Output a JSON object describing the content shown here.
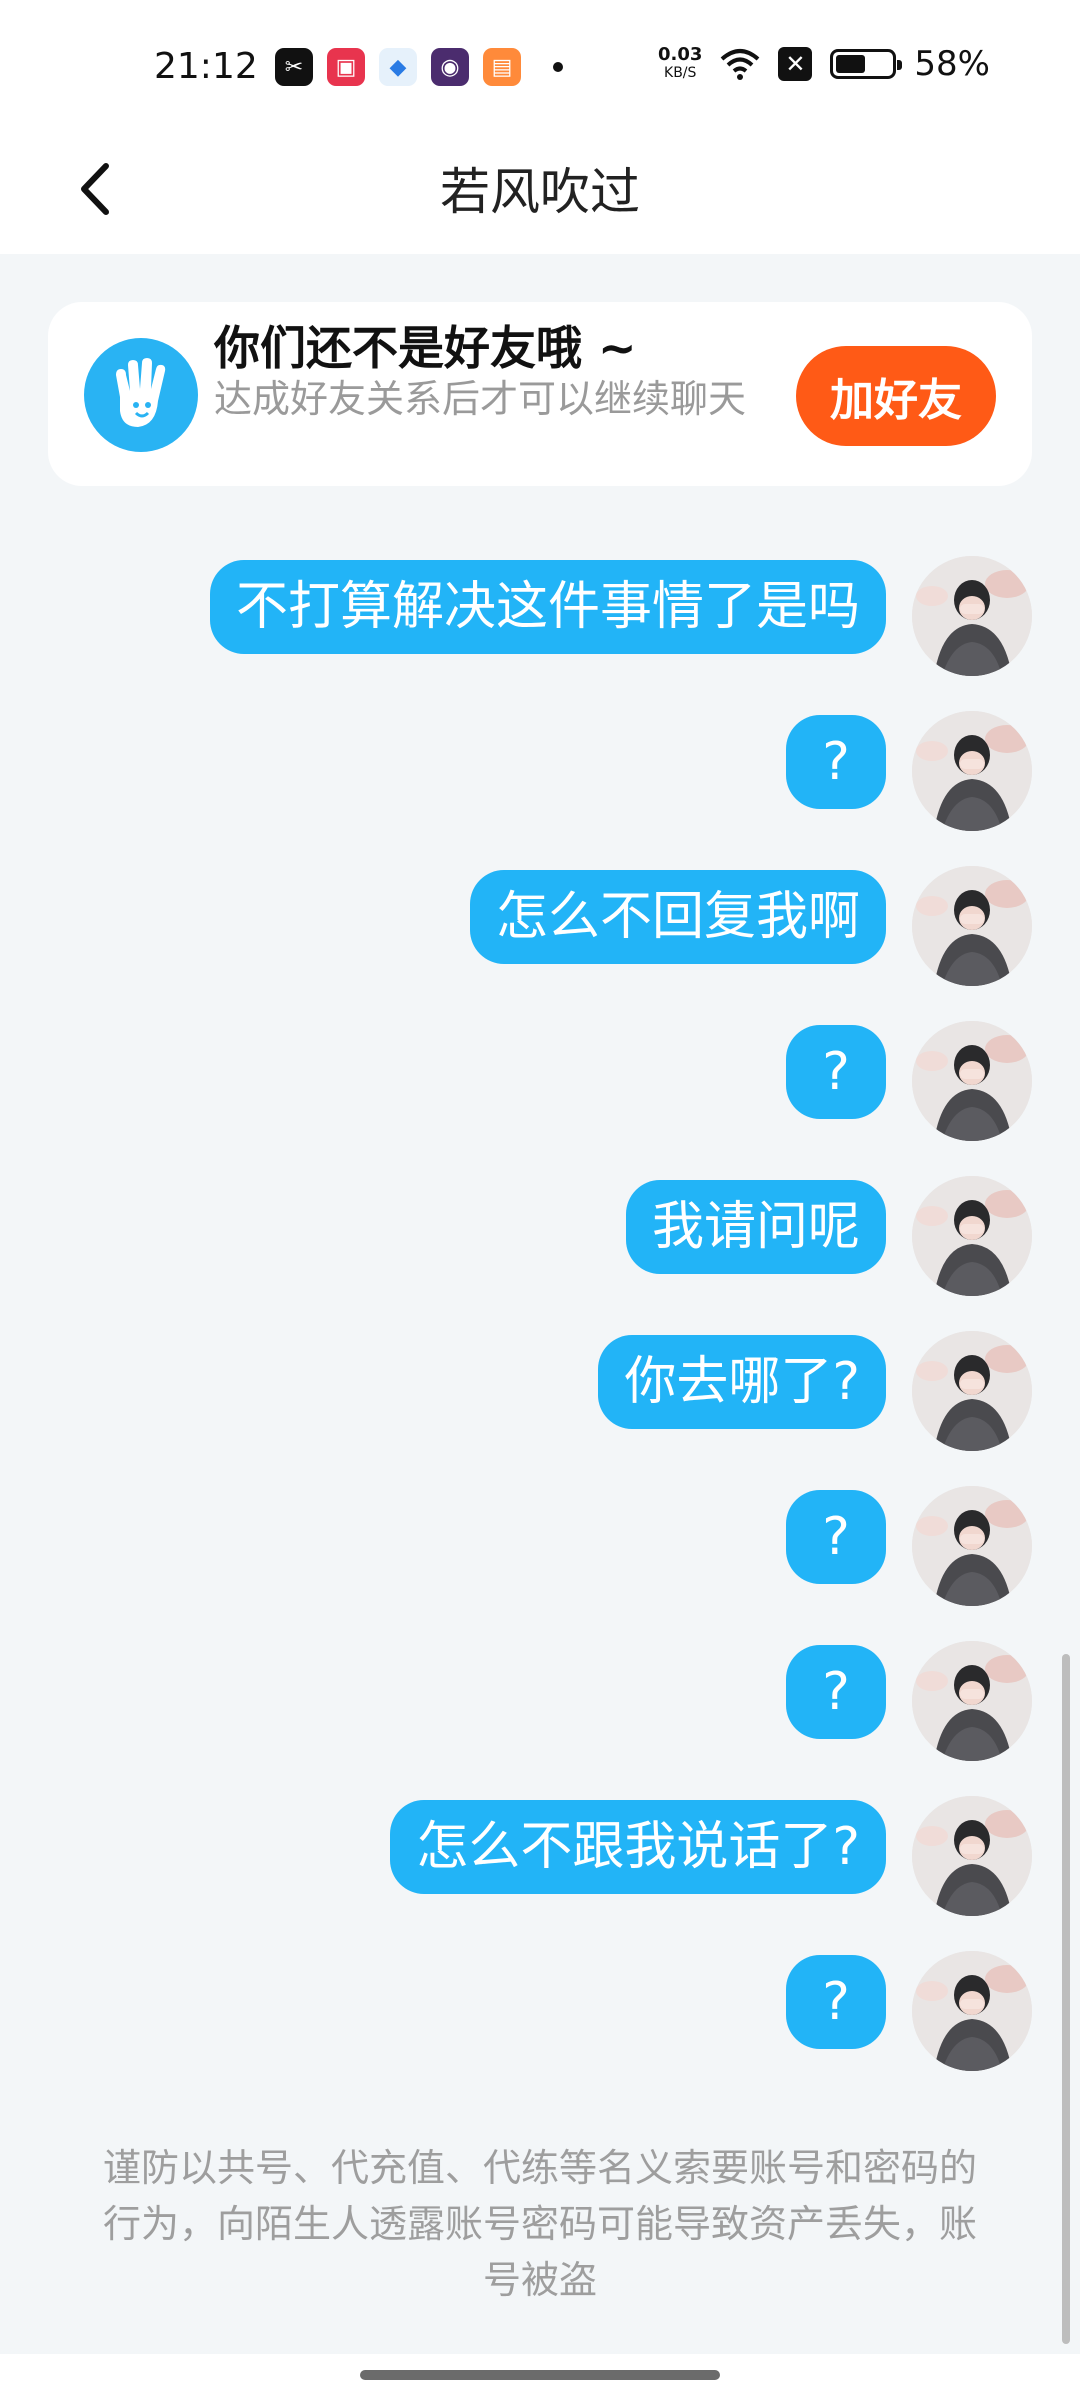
{
  "status_bar": {
    "time": "21:12",
    "notification_icons": [
      "capcut-icon",
      "video-recorder-icon",
      "app-icon",
      "game-icon",
      "book-icon"
    ],
    "net_speed": "0.03",
    "net_speed_unit": "KB/S",
    "battery_percent": "58%",
    "battery_level": 0.58
  },
  "header": {
    "title": "若风吹过"
  },
  "friend_banner": {
    "title": "你们还不是好友哦 ~",
    "description": "达成好友关系后才可以继续聊天",
    "add_button_label": "加好友"
  },
  "messages": [
    {
      "text": "不打算解决这件事情了是吗"
    },
    {
      "text": "?"
    },
    {
      "text": "怎么不回复我啊"
    },
    {
      "text": "?"
    },
    {
      "text": "我请问呢"
    },
    {
      "text": "你去哪了?"
    },
    {
      "text": "?"
    },
    {
      "text": "?"
    },
    {
      "text": "怎么不跟我说话了?"
    },
    {
      "text": "?"
    }
  ],
  "warning_text": "谨防以共号、代充值、代练等名义索要账号和密码的行为，向陌生人透露账号密码可能导致资产丢失，账号被盗",
  "colors": {
    "bubble": "#22b4f7",
    "add_button": "#ff5a16",
    "background": "#f3f6f8"
  }
}
